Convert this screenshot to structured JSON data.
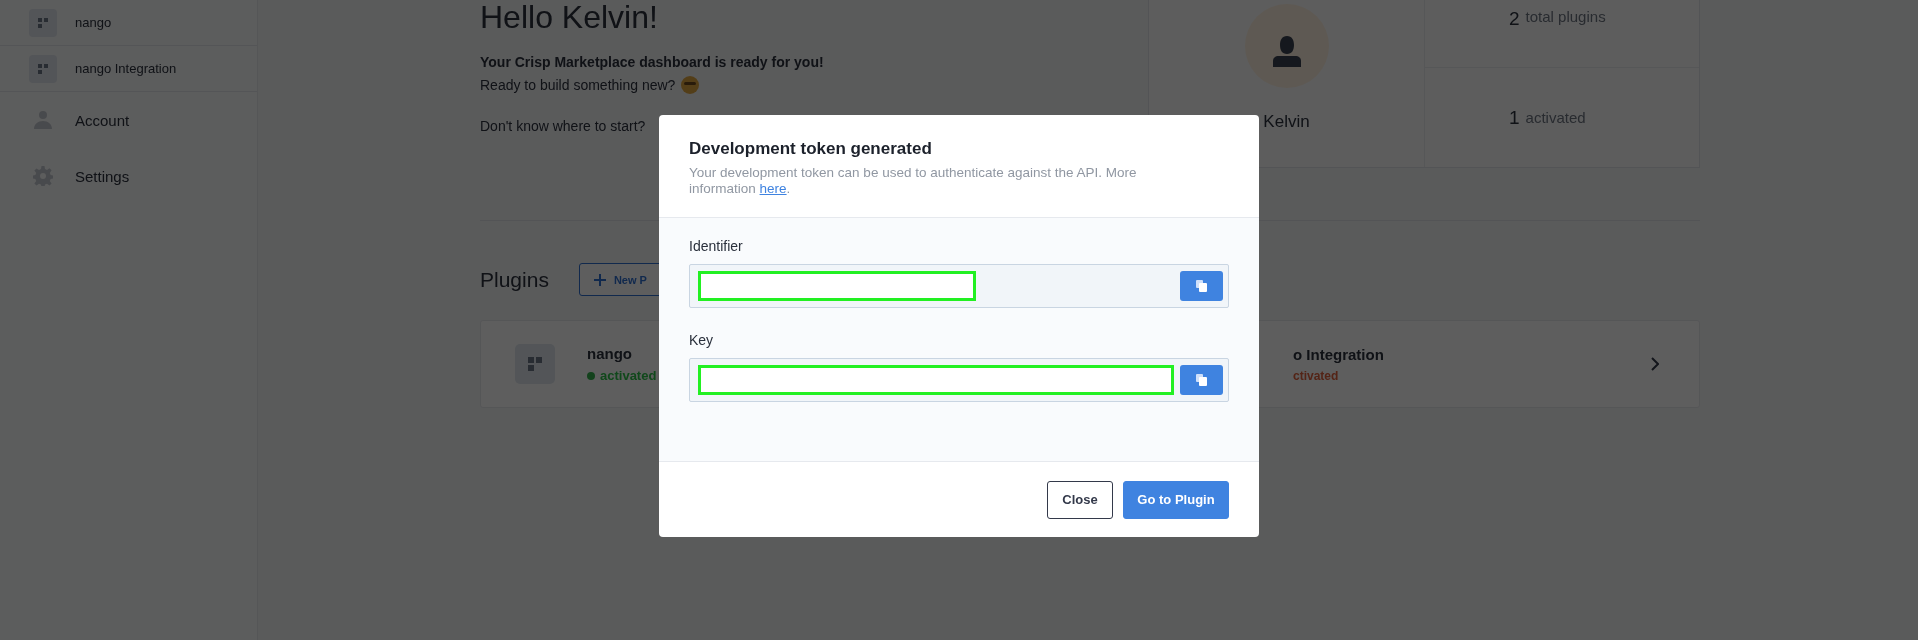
{
  "sidebar": {
    "plugins": [
      {
        "name": "nango"
      },
      {
        "name": "nango Integration"
      }
    ],
    "nav": [
      {
        "label": "Account",
        "kind": "account"
      },
      {
        "label": "Settings",
        "kind": "settings"
      }
    ]
  },
  "welcome": {
    "title": "Hello Kelvin!",
    "headline": "Your Crisp Marketplace dashboard is ready for you!",
    "line": "Ready to build something new?",
    "hint": "Don't know where to start?"
  },
  "profile": {
    "name": "Kelvin",
    "stats": [
      {
        "value": "2",
        "label": "total plugins"
      },
      {
        "value": "1",
        "label": "activated"
      }
    ]
  },
  "plugins": {
    "title": "Plugins",
    "new_button": "New P",
    "items": [
      {
        "name": "nango",
        "status": "activated",
        "active": true
      },
      {
        "name": "o Integration",
        "status": "ctivated",
        "active": false
      }
    ]
  },
  "modal": {
    "title": "Development token generated",
    "description": "Your development token can be used to authenticate against the API. More information",
    "link": "here",
    "link_after": ".",
    "fields": [
      {
        "label": "Identifier"
      },
      {
        "label": "Key"
      }
    ],
    "buttons": [
      {
        "label": "Close",
        "kind": "secondary"
      },
      {
        "label": "Go to Plugin",
        "kind": "primary"
      }
    ]
  }
}
